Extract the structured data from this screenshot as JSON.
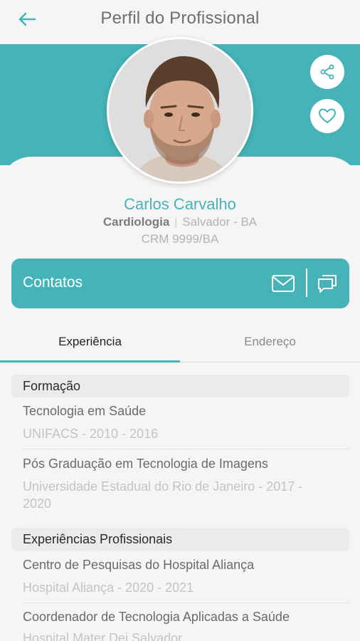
{
  "header": {
    "title": "Perfil do Profissional"
  },
  "profile": {
    "name": "Carlos Carvalho",
    "specialty": "Cardiologia",
    "separator": "|",
    "location": "Salvador - BA",
    "crm": "CRM 9999/BA"
  },
  "contacts": {
    "label": "Contatos"
  },
  "tabs": [
    {
      "label": "Experiência",
      "active": true
    },
    {
      "label": "Endereço",
      "active": false
    }
  ],
  "sections": {
    "formacao": {
      "title": "Formação",
      "items": [
        {
          "title": "Tecnologia em Saúde",
          "subtitle": "UNIFACS - 2010 - 2016"
        },
        {
          "title": "Pós Graduação em Tecnologia de Imagens",
          "subtitle": "Universidade Estadual do Rio de Janeiro - 2017 - 2020"
        }
      ]
    },
    "experiencias": {
      "title": "Experiências Profissionais",
      "items": [
        {
          "title": "Centro de Pesquisas do Hospital Aliança",
          "subtitle": "Hospital Aliança - 2020 - 2021"
        },
        {
          "title": "Coordenador de Tecnologia Aplicadas a Saúde",
          "subtitle": "Hospital Mater Dei Salvador"
        }
      ]
    }
  },
  "colors": {
    "accent": "#45b3b8",
    "background": "#f5f5f5"
  },
  "icons": [
    "back-arrow-icon",
    "share-icon",
    "heart-icon",
    "mail-icon",
    "chat-icon"
  ]
}
